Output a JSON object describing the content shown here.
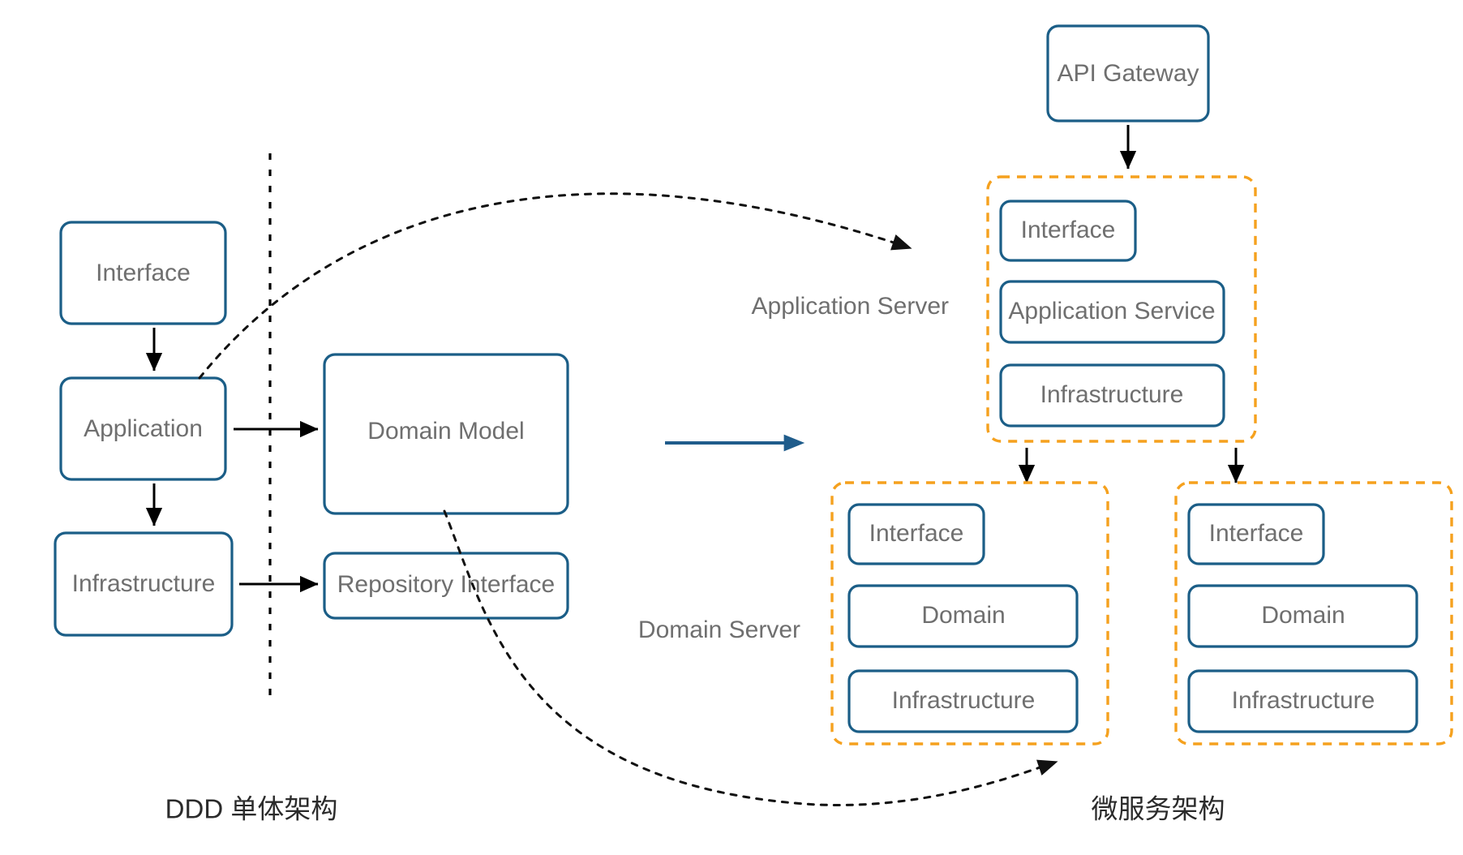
{
  "diagram": {
    "title_left": "DDD 单体架构",
    "title_right": "微服务架构",
    "accent_blue": "#1b5e87",
    "accent_orange": "#f5a11e",
    "text_gray": "#6f6f6f"
  },
  "monolith": {
    "layers": [
      {
        "label": "Interface"
      },
      {
        "label": "Application"
      },
      {
        "label": "Infrastructure"
      }
    ],
    "domain": [
      {
        "label": "Domain Model"
      },
      {
        "label": "Repository Interface"
      }
    ]
  },
  "microservices": {
    "gateway": {
      "label": "API Gateway"
    },
    "application_server": {
      "side_label": "Application Server",
      "items": [
        {
          "label": "Interface"
        },
        {
          "label": "Application Service"
        },
        {
          "label": "Infrastructure"
        }
      ]
    },
    "domain_server": {
      "side_label": "Domain Server",
      "groups": [
        {
          "items": [
            {
              "label": "Interface"
            },
            {
              "label": "Domain"
            },
            {
              "label": "Infrastructure"
            }
          ]
        },
        {
          "items": [
            {
              "label": "Interface"
            },
            {
              "label": "Domain"
            },
            {
              "label": "Infrastructure"
            }
          ]
        }
      ]
    }
  }
}
